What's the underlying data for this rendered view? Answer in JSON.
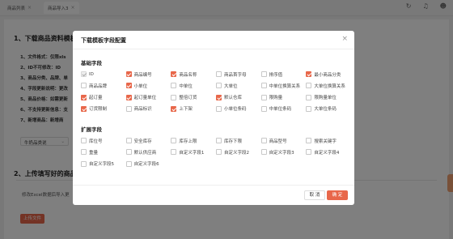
{
  "tabs": [
    {
      "label": "商品列表"
    },
    {
      "label": "商品导入3"
    }
  ],
  "background": {
    "section1_title": "1、下载商品资料模板",
    "lines": [
      "1、文件格式：仅限xls",
      "2、ID不可修改：ID",
      "3、商品分类、品牌、单",
      "4、字段更新说明：更改",
      "5、商品价格：如需更新",
      "6、不支持更新信息：支",
      "7、新增商品：新增商"
    ],
    "select_value": "牛奶品类说",
    "section2_title": "2、上传填写好的商品",
    "upload_hint": "修改Excel数据后导入更",
    "upload_button": "上传文件"
  },
  "modal": {
    "title": "下载模板字段配置",
    "basic_section": "基础字段",
    "basic_fields": [
      {
        "label": "ID",
        "state": "disabled"
      },
      {
        "label": "商品编号",
        "state": "checked"
      },
      {
        "label": "商品名称",
        "state": "checked"
      },
      {
        "label": "商品首字母",
        "state": "unchecked"
      },
      {
        "label": "排序值",
        "state": "unchecked"
      },
      {
        "label": "最小商品分类",
        "state": "checked"
      },
      {
        "label": "商品品牌",
        "state": "unchecked"
      },
      {
        "label": "小单位",
        "state": "checked"
      },
      {
        "label": "中单位",
        "state": "unchecked"
      },
      {
        "label": "大单位",
        "state": "unchecked"
      },
      {
        "label": "中单位换算关系",
        "state": "unchecked"
      },
      {
        "label": "大单位换算关系",
        "state": "unchecked"
      },
      {
        "label": "起订量",
        "state": "checked"
      },
      {
        "label": "起订量单位",
        "state": "checked"
      },
      {
        "label": "整倍订货",
        "state": "unchecked"
      },
      {
        "label": "默认仓库",
        "state": "checked"
      },
      {
        "label": "限购量",
        "state": "unchecked"
      },
      {
        "label": "限购量单位",
        "state": "unchecked"
      },
      {
        "label": "订货限制",
        "state": "checked"
      },
      {
        "label": "商品标识",
        "state": "unchecked"
      },
      {
        "label": "上下架",
        "state": "checked"
      },
      {
        "label": "小单位条码",
        "state": "unchecked"
      },
      {
        "label": "中单位条码",
        "state": "unchecked"
      },
      {
        "label": "大单位条码",
        "state": "unchecked"
      }
    ],
    "extended_section": "扩展字段",
    "extended_fields": [
      {
        "label": "库位号",
        "state": "unchecked"
      },
      {
        "label": "安全库存",
        "state": "unchecked"
      },
      {
        "label": "库存上限",
        "state": "unchecked"
      },
      {
        "label": "库存下限",
        "state": "unchecked"
      },
      {
        "label": "商品型号",
        "state": "unchecked"
      },
      {
        "label": "搜索关键字",
        "state": "unchecked"
      },
      {
        "label": "重量",
        "state": "unchecked"
      },
      {
        "label": "默认供应商",
        "state": "unchecked"
      },
      {
        "label": "自定义字段1",
        "state": "unchecked"
      },
      {
        "label": "自定义字段2",
        "state": "unchecked"
      },
      {
        "label": "自定义字段3",
        "state": "unchecked"
      },
      {
        "label": "自定义字段4",
        "state": "unchecked"
      },
      {
        "label": "自定义字段5",
        "state": "unchecked"
      },
      {
        "label": "自定义字段6",
        "state": "unchecked"
      }
    ],
    "cancel_label": "取 消",
    "confirm_label": "确 定"
  },
  "colors": {
    "accent": "#e8674a"
  }
}
